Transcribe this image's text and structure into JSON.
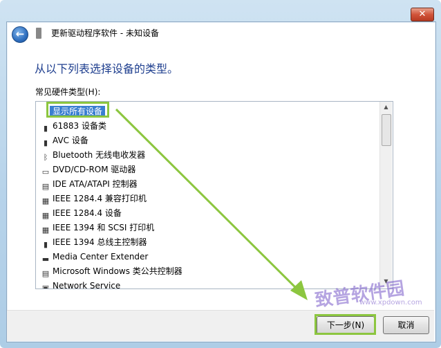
{
  "window": {
    "close_label": "✕"
  },
  "header": {
    "title": "更新驱动程序软件 - 未知设备"
  },
  "main": {
    "heading": "从以下列表选择设备的类型。",
    "list_label": "常见硬件类型(H):",
    "items": [
      {
        "label": "显示所有设备",
        "icon": "none",
        "selected": true
      },
      {
        "label": "61883 设备类",
        "icon": "plug-icon"
      },
      {
        "label": "AVC 设备",
        "icon": "plug-icon"
      },
      {
        "label": "Bluetooth 无线电收发器",
        "icon": "bluetooth-icon"
      },
      {
        "label": "DVD/CD-ROM 驱动器",
        "icon": "disc-drive-icon"
      },
      {
        "label": "IDE ATA/ATAPI 控制器",
        "icon": "controller-icon"
      },
      {
        "label": "IEEE 1284.4 兼容打印机",
        "icon": "printer-icon"
      },
      {
        "label": "IEEE 1284.4 设备",
        "icon": "printer-icon"
      },
      {
        "label": "IEEE 1394 和 SCSI 打印机",
        "icon": "printer-icon"
      },
      {
        "label": "IEEE 1394 总线主控制器",
        "icon": "plug-icon"
      },
      {
        "label": "Media Center Extender",
        "icon": "monitor-icon"
      },
      {
        "label": "Microsoft Windows 类公共控制器",
        "icon": "controller-icon"
      },
      {
        "label": "Network Service",
        "icon": "network-icon"
      }
    ]
  },
  "footer": {
    "next_label": "下一步(N)",
    "cancel_label": "取消"
  },
  "watermark": {
    "text": "致普软件园",
    "sub": "www.xpdown.com"
  },
  "colors": {
    "highlight": "#8cc63f",
    "selection": "#3a7fd0",
    "heading": "#1f3f8f"
  }
}
